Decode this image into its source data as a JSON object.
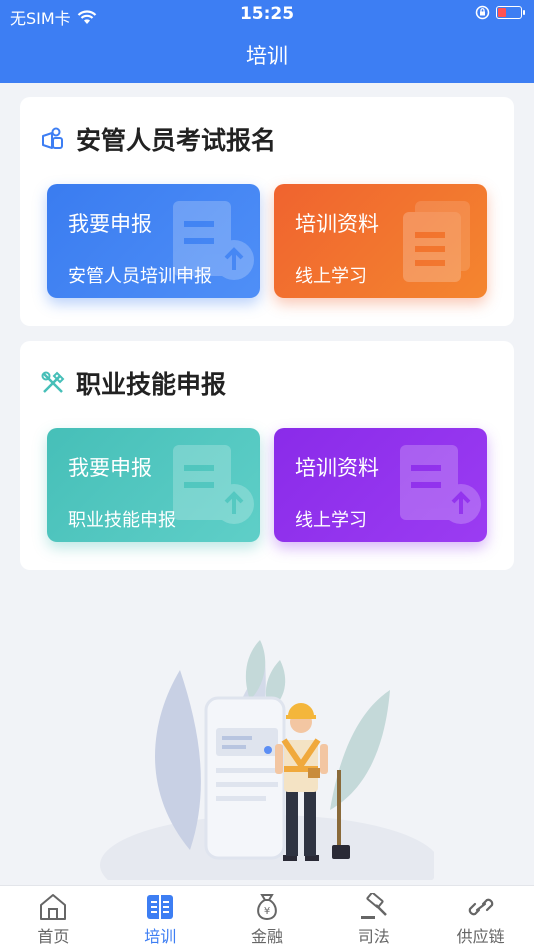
{
  "status": {
    "carrier": "无SIM卡",
    "time": "15:25"
  },
  "header": {
    "title": "培训"
  },
  "section1": {
    "title": "安管人员考试报名",
    "left": {
      "title": "我要申报",
      "subtitle": "安管人员培训申报"
    },
    "right": {
      "title": "培训资料",
      "subtitle": "线上学习"
    }
  },
  "section2": {
    "title": "职业技能申报",
    "left": {
      "title": "我要申报",
      "subtitle": "职业技能申报"
    },
    "right": {
      "title": "培训资料",
      "subtitle": "线上学习"
    }
  },
  "tabs": [
    {
      "label": "首页",
      "icon": "home-icon",
      "active": false
    },
    {
      "label": "培训",
      "icon": "book-icon",
      "active": true
    },
    {
      "label": "金融",
      "icon": "money-bag-icon",
      "active": false
    },
    {
      "label": "司法",
      "icon": "gavel-icon",
      "active": false
    },
    {
      "label": "供应链",
      "icon": "link-icon",
      "active": false
    }
  ],
  "colors": {
    "primary": "#3d7ef3",
    "blue_tile": "#3a7cf0",
    "orange_tile": "#f0632f",
    "teal_tile": "#46bfb8",
    "purple_tile": "#8a2be9"
  }
}
